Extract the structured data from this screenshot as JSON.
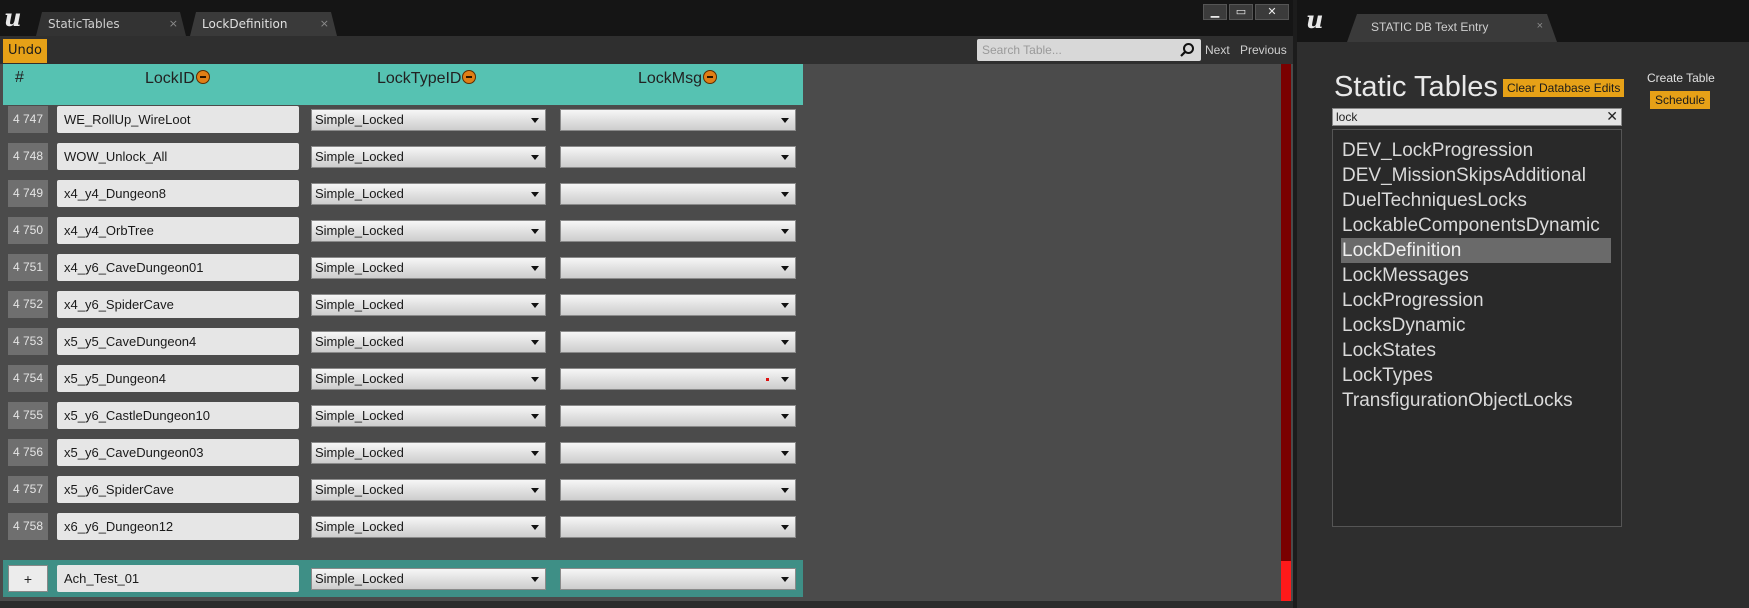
{
  "left_window": {
    "tabs": [
      {
        "label": "StaticTables",
        "close": "×"
      },
      {
        "label": "LockDefinition",
        "close": "×"
      }
    ],
    "window_buttons": {
      "minimize": "▁",
      "maximize": "▭",
      "close": "✕"
    },
    "toolbar": {
      "undo_label": "Undo",
      "search_placeholder": "Search Table...",
      "next_label": "Next",
      "previous_label": "Previous"
    },
    "table": {
      "columns": [
        "#",
        "LockID",
        "LockTypeID",
        "LockMsg"
      ],
      "rows": [
        {
          "num": "4 747",
          "lock_id": "WE_RollUp_WireLoot",
          "lock_type": "Simple_Locked",
          "lock_msg": ""
        },
        {
          "num": "4 748",
          "lock_id": "WOW_Unlock_All",
          "lock_type": "Simple_Locked",
          "lock_msg": ""
        },
        {
          "num": "4 749",
          "lock_id": "x4_y4_Dungeon8",
          "lock_type": "Simple_Locked",
          "lock_msg": ""
        },
        {
          "num": "4 750",
          "lock_id": "x4_y4_OrbTree",
          "lock_type": "Simple_Locked",
          "lock_msg": ""
        },
        {
          "num": "4 751",
          "lock_id": "x4_y6_CaveDungeon01",
          "lock_type": "Simple_Locked",
          "lock_msg": ""
        },
        {
          "num": "4 752",
          "lock_id": "x4_y6_SpiderCave",
          "lock_type": "Simple_Locked",
          "lock_msg": ""
        },
        {
          "num": "4 753",
          "lock_id": "x5_y5_CaveDungeon4",
          "lock_type": "Simple_Locked",
          "lock_msg": ""
        },
        {
          "num": "4 754",
          "lock_id": "x5_y5_Dungeon4",
          "lock_type": "Simple_Locked",
          "lock_msg": ""
        },
        {
          "num": "4 755",
          "lock_id": "x5_y6_CastleDungeon10",
          "lock_type": "Simple_Locked",
          "lock_msg": ""
        },
        {
          "num": "4 756",
          "lock_id": "x5_y6_CaveDungeon03",
          "lock_type": "Simple_Locked",
          "lock_msg": ""
        },
        {
          "num": "4 757",
          "lock_id": "x5_y6_SpiderCave",
          "lock_type": "Simple_Locked",
          "lock_msg": ""
        },
        {
          "num": "4 758",
          "lock_id": "x6_y6_Dungeon12",
          "lock_type": "Simple_Locked",
          "lock_msg": ""
        }
      ],
      "new_row": {
        "add_label": "+",
        "lock_id": "Ach_Test_01",
        "lock_type": "Simple_Locked",
        "lock_msg": ""
      }
    }
  },
  "right_window": {
    "tab_label": "STATIC DB Text Entry",
    "tab_close": "×",
    "title": "Static Tables",
    "clear_edits_label": "Clear Database Edits",
    "create_table_label": "Create Table",
    "schedule_label": "Schedule",
    "filter_value": "lock",
    "clear_filter": "✕",
    "results": [
      "DEV_LockProgression",
      "DEV_MissionSkipsAdditional",
      "DuelTechniquesLocks",
      "LockableComponentsDynamic",
      "LockDefinition",
      "LockMessages",
      "LockProgression",
      "LocksDynamic",
      "LockStates",
      "LockTypes",
      "TransfigurationObjectLocks"
    ],
    "selected_result": "LockDefinition"
  },
  "colors": {
    "accent_button": "#e6a117",
    "table_header": "#56c2b2",
    "new_row": "#3e8f86",
    "scrollbar_track": "#7a0000",
    "scrollbar_thumb": "#ff1a1a"
  }
}
